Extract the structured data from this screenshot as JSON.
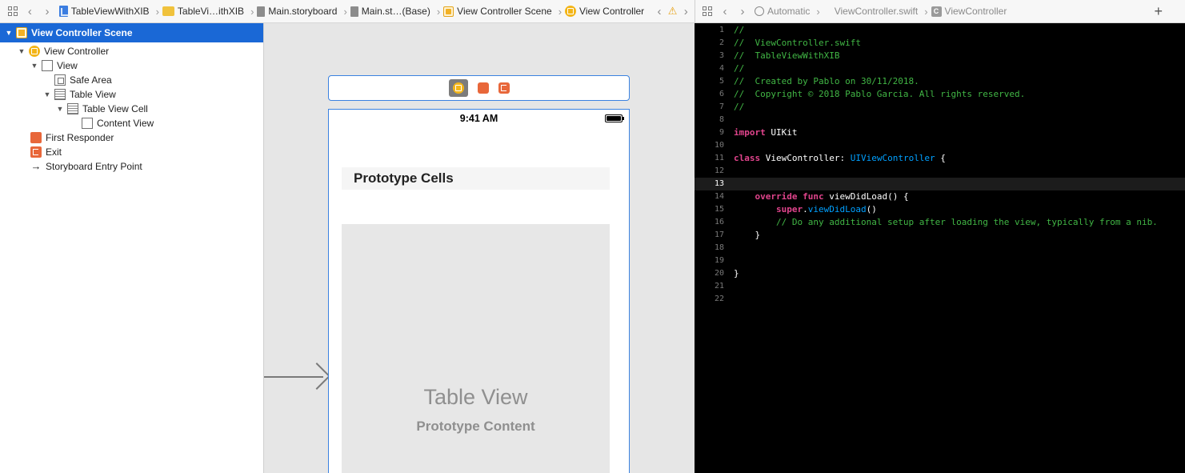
{
  "storyboard_jumpbar": {
    "crumbs": [
      "TableViewWithXIB",
      "TableVi…ithXIB",
      "Main.storyboard",
      "Main.st…(Base)",
      "View Controller Scene",
      "View Controller"
    ]
  },
  "outline": {
    "items": [
      {
        "label": "View Controller Scene"
      },
      {
        "label": "View Controller"
      },
      {
        "label": "View"
      },
      {
        "label": "Safe Area"
      },
      {
        "label": "Table View"
      },
      {
        "label": "Table View Cell"
      },
      {
        "label": "Content View"
      },
      {
        "label": "First Responder"
      },
      {
        "label": "Exit"
      },
      {
        "label": "Storyboard Entry Point"
      }
    ]
  },
  "canvas": {
    "status_time": "9:41 AM",
    "prototype_header": "Prototype Cells",
    "table_title": "Table View",
    "table_subtitle": "Prototype Content"
  },
  "editor_jumpbar": {
    "mode": "Automatic",
    "file": "ViewController.swift",
    "symbol": "ViewController",
    "symbol_icon": "C"
  },
  "editor": {
    "current_line": 13,
    "lines": [
      {
        "n": "1",
        "tokens": [
          {
            "t": "//",
            "c": "cmt"
          }
        ]
      },
      {
        "n": "2",
        "tokens": [
          {
            "t": "//  ViewController.swift",
            "c": "cmt"
          }
        ]
      },
      {
        "n": "3",
        "tokens": [
          {
            "t": "//  TableViewWithXIB",
            "c": "cmt"
          }
        ]
      },
      {
        "n": "4",
        "tokens": [
          {
            "t": "//",
            "c": "cmt"
          }
        ]
      },
      {
        "n": "5",
        "tokens": [
          {
            "t": "//  Created by Pablo on 30/11/2018.",
            "c": "cmt"
          }
        ]
      },
      {
        "n": "6",
        "tokens": [
          {
            "t": "//  Copyright © 2018 Pablo Garcia. All rights reserved.",
            "c": "cmt"
          }
        ]
      },
      {
        "n": "7",
        "tokens": [
          {
            "t": "//",
            "c": "cmt"
          }
        ]
      },
      {
        "n": "8",
        "tokens": []
      },
      {
        "n": "9",
        "tokens": [
          {
            "t": "import",
            "c": "kw"
          },
          {
            "t": " UIKit",
            "c": "plain"
          }
        ]
      },
      {
        "n": "10",
        "tokens": []
      },
      {
        "n": "11",
        "tokens": [
          {
            "t": "class",
            "c": "kw"
          },
          {
            "t": " ViewController: ",
            "c": "plain"
          },
          {
            "t": "UIViewController",
            "c": "type"
          },
          {
            "t": " {",
            "c": "plain"
          }
        ]
      },
      {
        "n": "12",
        "tokens": []
      },
      {
        "n": "13",
        "tokens": []
      },
      {
        "n": "14",
        "tokens": [
          {
            "t": "    ",
            "c": "plain"
          },
          {
            "t": "override",
            "c": "kw"
          },
          {
            "t": " ",
            "c": "plain"
          },
          {
            "t": "func",
            "c": "kw"
          },
          {
            "t": " viewDidLoad() {",
            "c": "plain"
          }
        ]
      },
      {
        "n": "15",
        "tokens": [
          {
            "t": "        ",
            "c": "plain"
          },
          {
            "t": "super",
            "c": "kw"
          },
          {
            "t": ".",
            "c": "plain"
          },
          {
            "t": "viewDidLoad",
            "c": "type"
          },
          {
            "t": "()",
            "c": "plain"
          }
        ]
      },
      {
        "n": "16",
        "tokens": [
          {
            "t": "        ",
            "c": "plain"
          },
          {
            "t": "// Do any additional setup after loading the view, typically from a nib.",
            "c": "cmt"
          }
        ]
      },
      {
        "n": "17",
        "tokens": [
          {
            "t": "    }",
            "c": "plain"
          }
        ]
      },
      {
        "n": "18",
        "tokens": []
      },
      {
        "n": "19",
        "tokens": []
      },
      {
        "n": "20",
        "tokens": [
          {
            "t": "}",
            "c": "plain"
          }
        ]
      },
      {
        "n": "21",
        "tokens": []
      },
      {
        "n": "22",
        "tokens": []
      }
    ]
  }
}
